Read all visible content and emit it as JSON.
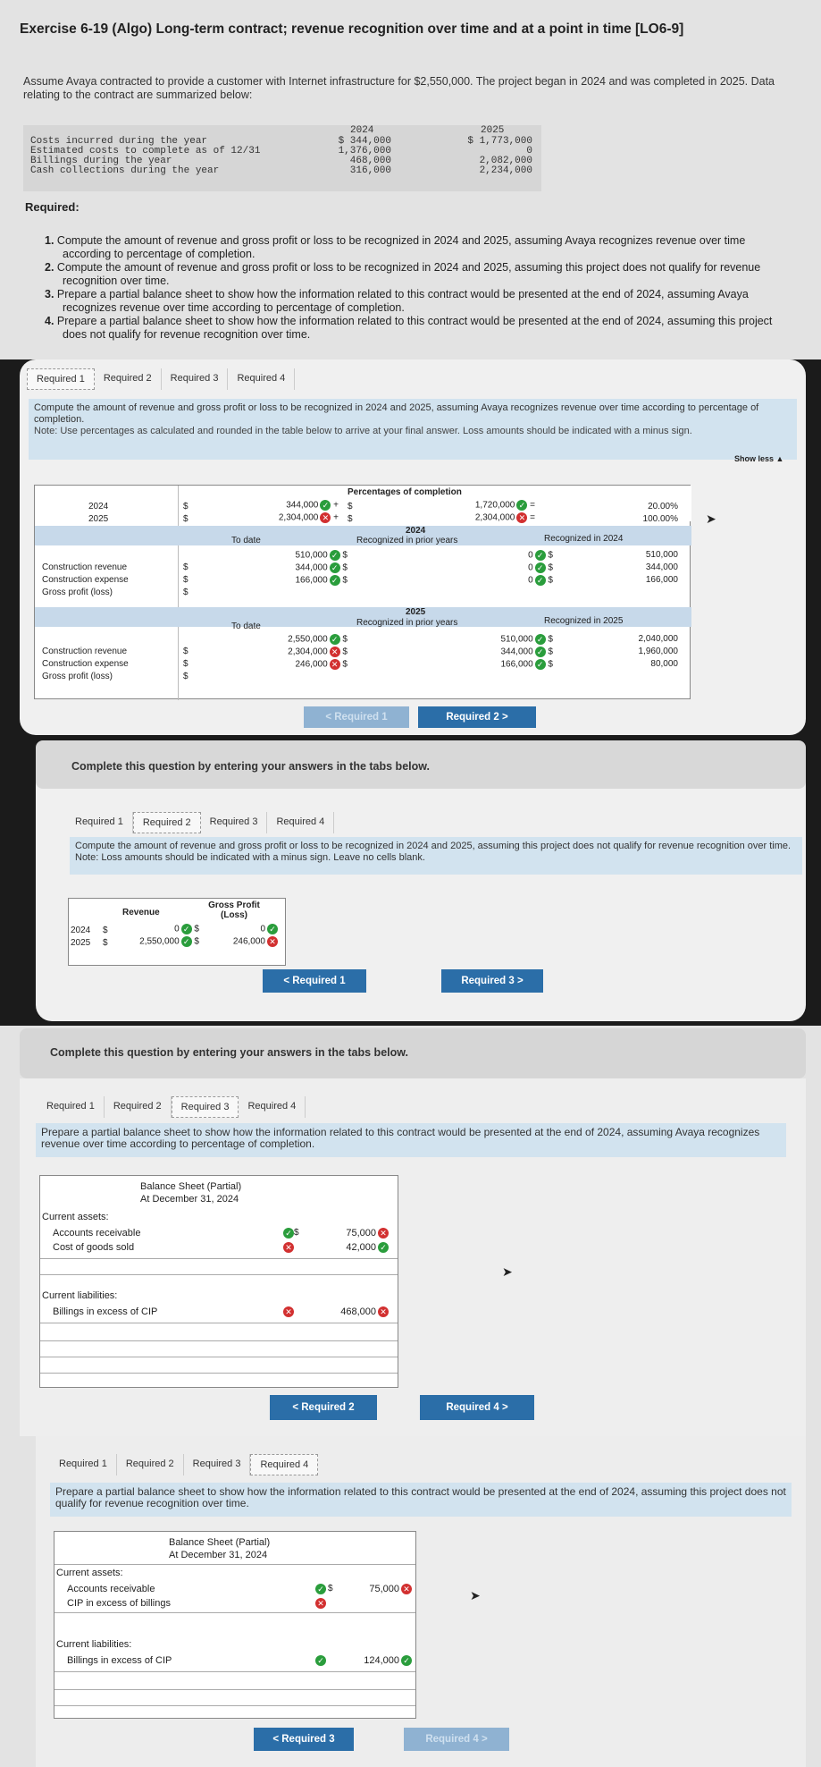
{
  "title": "Exercise 6-19 (Algo) Long-term contract; revenue recognition over time and at a point in time [LO6-9]",
  "intro": "Assume Avaya contracted to provide a customer with Internet infrastructure for $2,550,000. The project began in 2024 and was completed in 2025. Data relating to the contract are summarized below:",
  "data": {
    "y1": "2024",
    "y2": "2025",
    "rows": [
      {
        "label": "Costs incurred during the year",
        "v1": "$ 344,000",
        "v2": "$ 1,773,000"
      },
      {
        "label": "Estimated costs to complete as of 12/31",
        "v1": "1,376,000",
        "v2": "0"
      },
      {
        "label": "Billings during the year",
        "v1": "468,000",
        "v2": "2,082,000"
      },
      {
        "label": "Cash collections during the year",
        "v1": "316,000",
        "v2": "2,234,000"
      }
    ]
  },
  "required_label": "Required:",
  "requirements": [
    {
      "n": "1.",
      "t": "Compute the amount of revenue and gross profit or loss to be recognized in 2024 and 2025, assuming Avaya recognizes revenue over time according to percentage of completion."
    },
    {
      "n": "2.",
      "t": "Compute the amount of revenue and gross profit or loss to be recognized in 2024 and 2025, assuming this project does not qualify for revenue recognition over time."
    },
    {
      "n": "3.",
      "t": "Prepare a partial balance sheet to show how the information related to this contract would be presented at the end of 2024, assuming Avaya recognizes revenue over time according to percentage of completion."
    },
    {
      "n": "4.",
      "t": "Prepare a partial balance sheet to show how the information related to this contract would be presented at the end of 2024, assuming this project does not qualify for revenue recognition over time."
    }
  ],
  "tabs": [
    "Required 1",
    "Required 2",
    "Required 3",
    "Required 4"
  ],
  "p1": {
    "instr": "Compute the amount of revenue and gross profit or loss to be recognized in 2024 and 2025, assuming Avaya recognizes revenue over time according to percentage of completion.",
    "note": "Note: Use percentages as calculated and rounded in the table below to arrive at your final answer. Loss amounts should be indicated with a minus sign.",
    "show_less": "Show less ▲",
    "pct_header": "Percentages of completion",
    "y2024": "2024",
    "y2025": "2025",
    "a1": "344,000",
    "a2": "2,304,000",
    "b1": "1,720,000",
    "b2": "2,304,000",
    "p1": "20.00%",
    "p2": "100.00%",
    "to_date": "To date",
    "prior": "Recognized in prior years",
    "rec24": "Recognized in 2024",
    "rec25": "Recognized in 2025",
    "rows": [
      "Construction revenue",
      "Construction expense",
      "Gross profit (loss)"
    ],
    "td24": [
      "510,000",
      "344,000",
      "166,000"
    ],
    "pr24": [
      "0",
      "0",
      "0"
    ],
    "r24": [
      "510,000",
      "344,000",
      "166,000"
    ],
    "td25": [
      "2,550,000",
      "2,304,000",
      "246,000"
    ],
    "pr25": [
      "510,000",
      "344,000",
      "166,000"
    ],
    "r25": [
      "2,040,000",
      "1,960,000",
      "80,000"
    ],
    "prev": "< Required 1",
    "next": "Required 2 >"
  },
  "complete": "Complete this question by entering your answers in the tabs below.",
  "p2": {
    "instr": "Compute the amount of revenue and gross profit or loss to be recognized in 2024 and 2025, assuming this project does not qualify for revenue recognition over time.",
    "note": "Note: Loss amounts should be indicated with a minus sign. Leave no cells blank.",
    "h_rev": "Revenue",
    "h_gp": "Gross Profit (Loss)",
    "y1": "2024",
    "y2": "2025",
    "rev1": "0",
    "rev2": "2,550,000",
    "gp1": "0",
    "gp2": "246,000",
    "prev": "< Required 1",
    "next": "Required 3 >"
  },
  "p3": {
    "instr": "Prepare a partial balance sheet to show how the information related to this contract would be presented at the end of 2024, assuming Avaya recognizes revenue over time according to percentage of completion.",
    "bs": "Balance Sheet (Partial)",
    "at": "At December 31, 2024",
    "ca": "Current assets:",
    "ar": "Accounts receivable",
    "cogs": "Cost of goods sold",
    "v1": "75,000",
    "v2": "42,000",
    "cl": "Current liabilities:",
    "bill": "Billings in excess of CIP",
    "v3": "468,000",
    "prev": "< Required 2",
    "next": "Required 4 >"
  },
  "p4": {
    "instr": "Prepare a partial balance sheet to show how the information related to this contract would be presented at the end of 2024, assuming this project does not qualify for revenue recognition over time.",
    "bs": "Balance Sheet (Partial)",
    "at": "At December 31, 2024",
    "ca": "Current assets:",
    "ar": "Accounts receivable",
    "cip": "CIP in excess of billings",
    "v1": "75,000",
    "cl": "Current liabilities:",
    "bill": "Billings in excess of CIP",
    "v3": "124,000",
    "prev": "< Required 3",
    "next": "Required 4 >"
  }
}
